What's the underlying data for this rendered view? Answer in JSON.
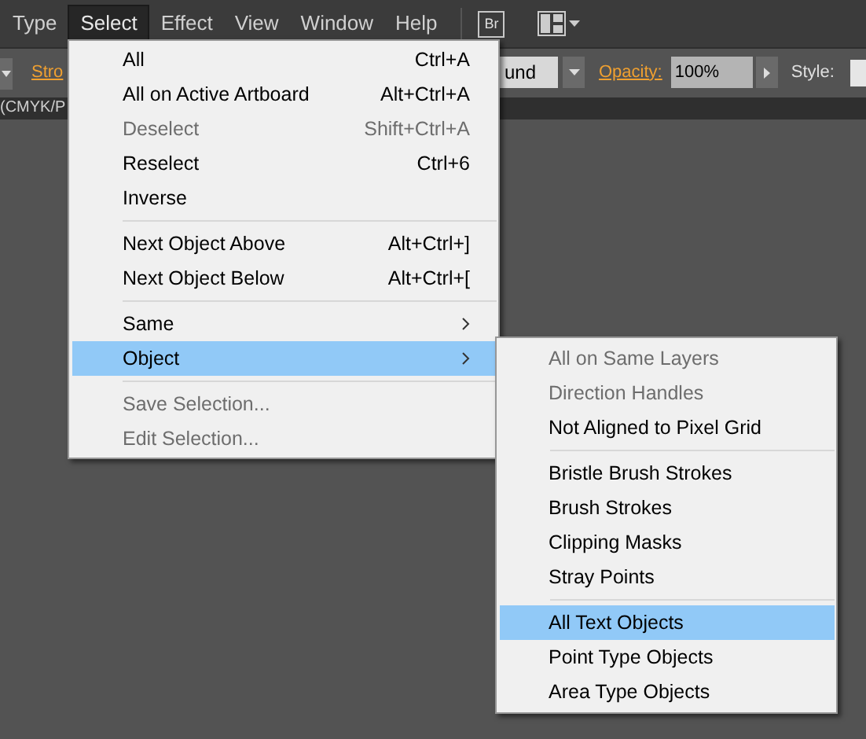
{
  "menubar": [
    {
      "label": "Type",
      "selected": false
    },
    {
      "label": "Select",
      "selected": true
    },
    {
      "label": "Effect",
      "selected": false
    },
    {
      "label": "View",
      "selected": false
    },
    {
      "label": "Window",
      "selected": false
    },
    {
      "label": "Help",
      "selected": false
    }
  ],
  "bridge_button": "Br",
  "control_bar": {
    "stroke_label": "Stro",
    "cap_value": "und",
    "opacity_label": "Opacity:",
    "opacity_value": "100%",
    "style_label": "Style:"
  },
  "document_tab": "(CMYK/P",
  "select_menu": [
    {
      "kind": "item",
      "label": "All",
      "shortcut": "Ctrl+A",
      "disabled": false,
      "selected": false
    },
    {
      "kind": "item",
      "label": "All on Active Artboard",
      "shortcut": "Alt+Ctrl+A",
      "disabled": false,
      "selected": false
    },
    {
      "kind": "item",
      "label": "Deselect",
      "shortcut": "Shift+Ctrl+A",
      "disabled": true,
      "selected": false
    },
    {
      "kind": "item",
      "label": "Reselect",
      "shortcut": "Ctrl+6",
      "disabled": false,
      "selected": false
    },
    {
      "kind": "item",
      "label": "Inverse",
      "disabled": false,
      "selected": false
    },
    {
      "kind": "separator"
    },
    {
      "kind": "item",
      "label": "Next Object Above",
      "shortcut": "Alt+Ctrl+]",
      "disabled": false,
      "selected": false
    },
    {
      "kind": "item",
      "label": "Next Object Below",
      "shortcut": "Alt+Ctrl+[",
      "disabled": false,
      "selected": false
    },
    {
      "kind": "separator"
    },
    {
      "kind": "submenu",
      "label": "Same",
      "disabled": false,
      "selected": false
    },
    {
      "kind": "submenu",
      "label": "Object",
      "disabled": false,
      "selected": true
    },
    {
      "kind": "separator"
    },
    {
      "kind": "item",
      "label": "Save Selection...",
      "disabled": true,
      "selected": false
    },
    {
      "kind": "item",
      "label": "Edit Selection...",
      "disabled": true,
      "selected": false
    }
  ],
  "object_submenu": [
    {
      "kind": "item",
      "label": "All on Same Layers",
      "disabled": true,
      "selected": false
    },
    {
      "kind": "item",
      "label": "Direction Handles",
      "disabled": true,
      "selected": false
    },
    {
      "kind": "item",
      "label": "Not Aligned to Pixel Grid",
      "disabled": false,
      "selected": false
    },
    {
      "kind": "separator"
    },
    {
      "kind": "item",
      "label": "Bristle Brush Strokes",
      "disabled": false,
      "selected": false
    },
    {
      "kind": "item",
      "label": "Brush Strokes",
      "disabled": false,
      "selected": false
    },
    {
      "kind": "item",
      "label": "Clipping Masks",
      "disabled": false,
      "selected": false
    },
    {
      "kind": "item",
      "label": "Stray Points",
      "disabled": false,
      "selected": false
    },
    {
      "kind": "separator"
    },
    {
      "kind": "item",
      "label": "All Text Objects",
      "disabled": false,
      "selected": true
    },
    {
      "kind": "item",
      "label": "Point Type Objects",
      "disabled": false,
      "selected": false
    },
    {
      "kind": "item",
      "label": "Area Type Objects",
      "disabled": false,
      "selected": false
    }
  ]
}
